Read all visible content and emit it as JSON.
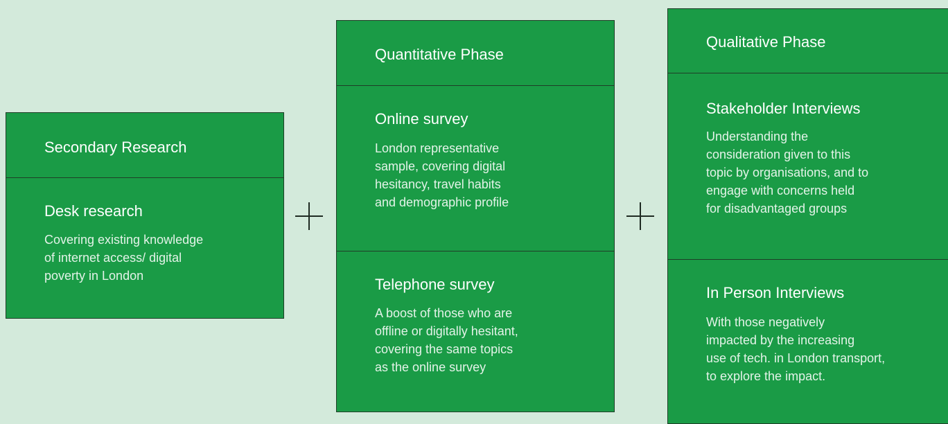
{
  "colors": {
    "background": "#d3eadb",
    "panel_fill": "#1a9b46",
    "panel_border": "#1f3d27",
    "text": "#ffffff",
    "plus": "#1e2a22"
  },
  "connectors": [
    "plus-icon",
    "plus-icon"
  ],
  "secondary": {
    "header": "Secondary Research",
    "desk": {
      "title": "Desk research",
      "body": "Covering existing knowledge\nof internet access/ digital\npoverty in London"
    }
  },
  "quantitative": {
    "header": "Quantitative Phase",
    "online": {
      "title": "Online survey",
      "body": "London representative\nsample, covering digital\nhesitancy, travel habits\nand demographic profile"
    },
    "telephone": {
      "title": "Telephone survey",
      "body": "A boost of those who are\noffline or digitally hesitant,\ncovering the same topics\nas the online survey"
    }
  },
  "qualitative": {
    "header": "Qualitative Phase",
    "stakeholder": {
      "title": "Stakeholder Interviews",
      "body": "Understanding the\nconsideration given to this\ntopic by organisations, and to\nengage with concerns held\nfor disadvantaged groups"
    },
    "in_person": {
      "title": "In Person Interviews",
      "body": "With those negatively\nimpacted by the increasing\nuse of tech. in London transport,\nto explore the impact."
    }
  }
}
